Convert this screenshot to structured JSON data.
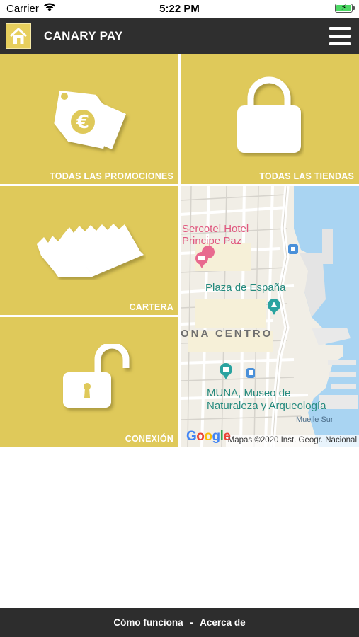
{
  "status_bar": {
    "carrier": "Carrier",
    "time": "5:22 PM"
  },
  "header": {
    "title": "CANARY PAY"
  },
  "tiles": [
    {
      "label": "TODAS LAS PROMOCIONES"
    },
    {
      "label": "TODAS LAS TIENDAS"
    },
    {
      "label": "CARTERA"
    },
    {
      "label": "CONEXIÓN"
    }
  ],
  "map": {
    "labels": {
      "hotel_line1": "Sercotel Hotel",
      "hotel_line2": "Principe Paz",
      "plaza": "Plaza de España",
      "district": "ONA CENTRO",
      "museum_line1": "MUNA, Museo de",
      "museum_line2": "Naturaleza y Arqueología",
      "muelle": "Muelle Sur"
    },
    "attribution": "Mapas ©2020 Inst. Geogr. Nacional",
    "logo": "Google"
  },
  "footer": {
    "link1": "Cómo funciona",
    "separator": "-",
    "link2": "Acerca de"
  },
  "colors": {
    "tile": "#dfc95a",
    "bar": "#2f2f2f",
    "sea": "#a9d4f2"
  }
}
